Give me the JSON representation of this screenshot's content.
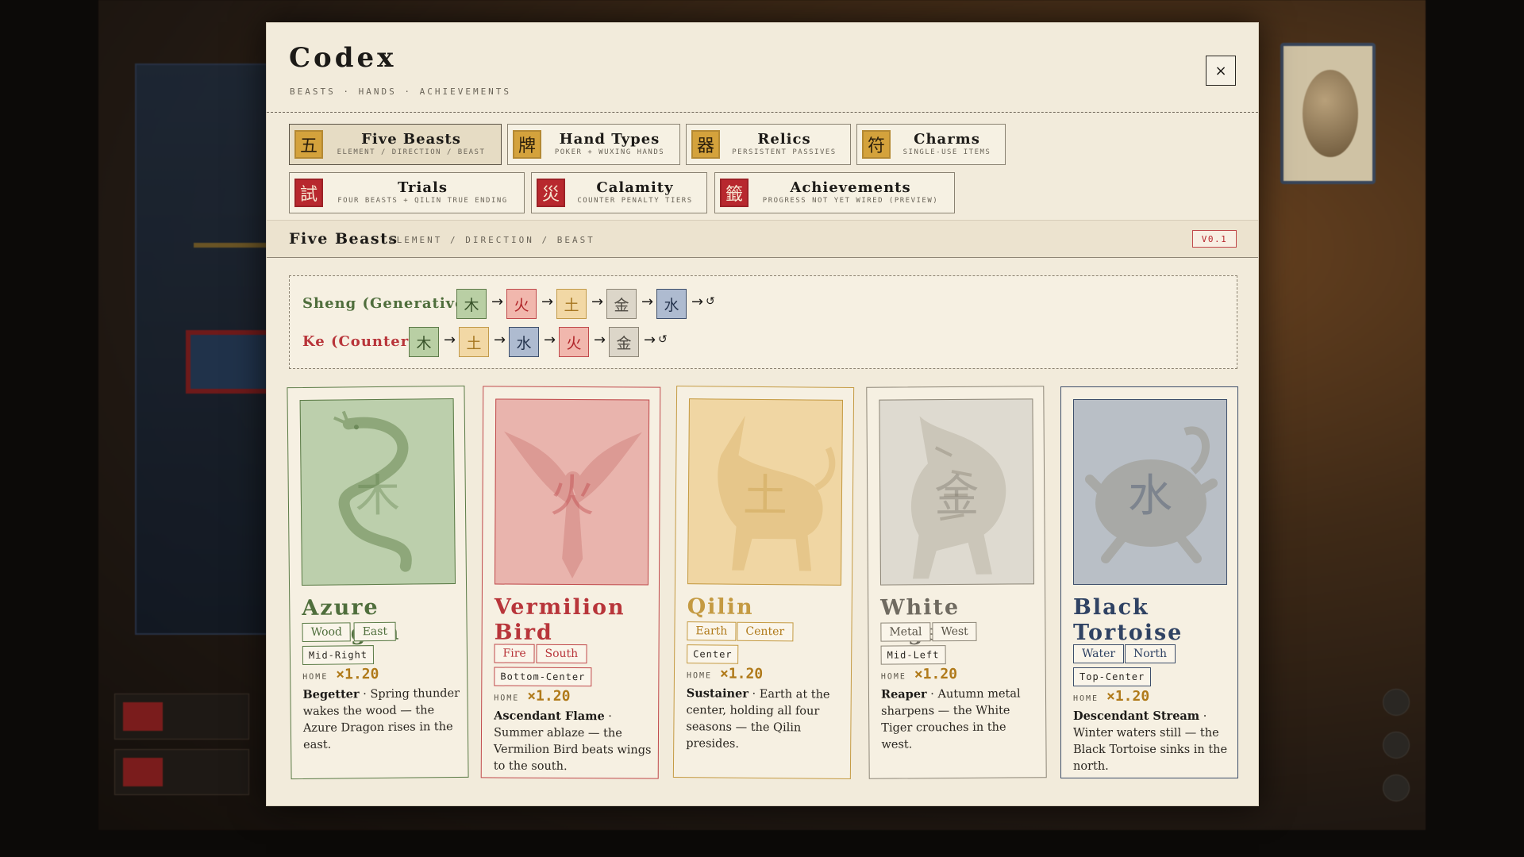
{
  "modal": {
    "title": "Codex",
    "subtitle": "BEASTS · HANDS · ACHIEVEMENTS",
    "close_label": "×"
  },
  "tabs": [
    {
      "seal": "五",
      "title": "Five Beasts",
      "sub": "ELEMENT / DIRECTION / BEAST",
      "active": true
    },
    {
      "seal": "牌",
      "title": "Hand Types",
      "sub": "POKER + WUXING HANDS",
      "active": false
    },
    {
      "seal": "器",
      "title": "Relics",
      "sub": "PERSISTENT PASSIVES",
      "active": false
    },
    {
      "seal": "符",
      "title": "Charms",
      "sub": "SINGLE-USE ITEMS",
      "active": false
    },
    {
      "seal": "試",
      "title": "Trials",
      "sub": "FOUR BEASTS + QILIN TRUE ENDING",
      "active": false
    },
    {
      "seal": "災",
      "title": "Calamity",
      "sub": "COUNTER PENALTY TIERS",
      "active": false
    },
    {
      "seal": "籤",
      "title": "Achievements",
      "sub": "PROGRESS NOT YET WIRED (PREVIEW)",
      "active": false
    }
  ],
  "section": {
    "title": "Five Beasts",
    "sub": "ELEMENT / DIRECTION / BEAST",
    "version": "V0.1"
  },
  "cycles": {
    "sheng": {
      "label": "Sheng (Generative)",
      "elements": [
        "木",
        "火",
        "土",
        "金",
        "水"
      ],
      "arrow": "→",
      "loop": "↺"
    },
    "ke": {
      "label": "Ke (Counter)",
      "elements": [
        "木",
        "土",
        "水",
        "火",
        "金"
      ],
      "arrow": "→",
      "loop": "↺"
    }
  },
  "beasts": [
    {
      "name": "Azure Dragon",
      "glyph": "木",
      "element": "Wood",
      "direction": "East",
      "position": "Mid-Right",
      "home_label": "HOME",
      "home_mult": "×1.20",
      "ability": "Begetter",
      "lore": "Spring thunder wakes the wood — the Azure Dragon rises in the east.",
      "color": "#5a7a45"
    },
    {
      "name": "Vermilion Bird",
      "glyph": "火",
      "element": "Fire",
      "direction": "South",
      "position": "Bottom-Center",
      "home_label": "HOME",
      "home_mult": "×1.20",
      "ability": "Ascendant Flame",
      "lore": "Summer ablaze — the Vermilion Bird beats wings to the south.",
      "color": "#b8353a"
    },
    {
      "name": "Qilin",
      "glyph": "土",
      "element": "Earth",
      "direction": "Center",
      "position": "Center",
      "home_label": "HOME",
      "home_mult": "×1.20",
      "ability": "Sustainer",
      "lore": "Earth at the center, holding all four seasons — the Qilin presides.",
      "color": "#c49a42"
    },
    {
      "name": "White Tiger",
      "glyph": "金",
      "element": "Metal",
      "direction": "West",
      "position": "Mid-Left",
      "home_label": "HOME",
      "home_mult": "×1.20",
      "ability": "Reaper",
      "lore": "Autumn metal sharpens — the White Tiger crouches in the west.",
      "color": "#6f6a60"
    },
    {
      "name": "Black Tortoise",
      "glyph": "水",
      "element": "Water",
      "direction": "North",
      "position": "Top-Center",
      "home_label": "HOME",
      "home_mult": "×1.20",
      "ability": "Descendant Stream",
      "lore": "Winter waters still — the Black Tortoise sinks in the north.",
      "color": "#2f4263"
    }
  ]
}
